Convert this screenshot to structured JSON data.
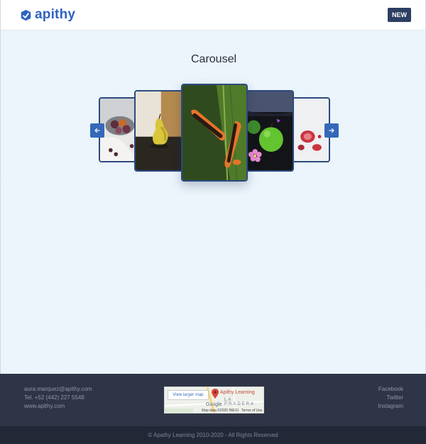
{
  "header": {
    "logo_text": "apithy",
    "new_button": "NEW"
  },
  "main": {
    "title": "Carousel",
    "carousel": {
      "prev_icon": "arrow-left-icon",
      "next_icon": "arrow-right-icon",
      "slides": [
        {
          "subject": "figs-bowl-photo"
        },
        {
          "subject": "pear-photo"
        },
        {
          "subject": "papaya-photo"
        },
        {
          "subject": "green-apple-photo"
        },
        {
          "subject": "figs-halves-photo"
        }
      ]
    }
  },
  "footer": {
    "contact": {
      "email": "aura.marquez@apithy.com",
      "phone": "Tel. +52 (442) 227 5548",
      "website": "www.apithy.com"
    },
    "map": {
      "button": "View larger map",
      "place": "Apithy Learning",
      "area": "LA PRADERA",
      "google": "Google",
      "credit": "Map data ©2020 INEGI",
      "terms": "Terms of Use"
    },
    "social": [
      "Facebook",
      "Twitter",
      "Instagram"
    ],
    "copyright": "© Apathy Learning 2010-2020 - All Rights Reserved"
  },
  "colors": {
    "accent": "#2f63c2",
    "dark_navy": "#2c3e63",
    "footer_bg": "#2f3546",
    "page_bg": "#e9f3fb"
  }
}
